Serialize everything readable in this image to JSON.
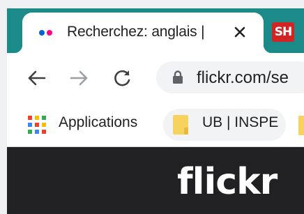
{
  "tabs": {
    "active": {
      "title": "Recherchez: anglais |",
      "favicon": "flickr-dots-icon"
    },
    "inactive": {
      "favicon_text": "SH"
    }
  },
  "toolbar": {
    "back_icon": "arrow-left-icon",
    "forward_icon": "arrow-right-icon",
    "reload_icon": "reload-icon",
    "url": "flickr.com/se"
  },
  "bookmarks": {
    "apps_label": "Applications",
    "items": [
      {
        "label": "UB | INSPE",
        "icon": "folder-icon"
      }
    ]
  },
  "page": {
    "logo_text": "flickr"
  },
  "colors": {
    "frame": "#1b8a88",
    "flickr_blue": "#0063dc",
    "flickr_pink": "#ff0084",
    "page_bg": "#212124"
  }
}
